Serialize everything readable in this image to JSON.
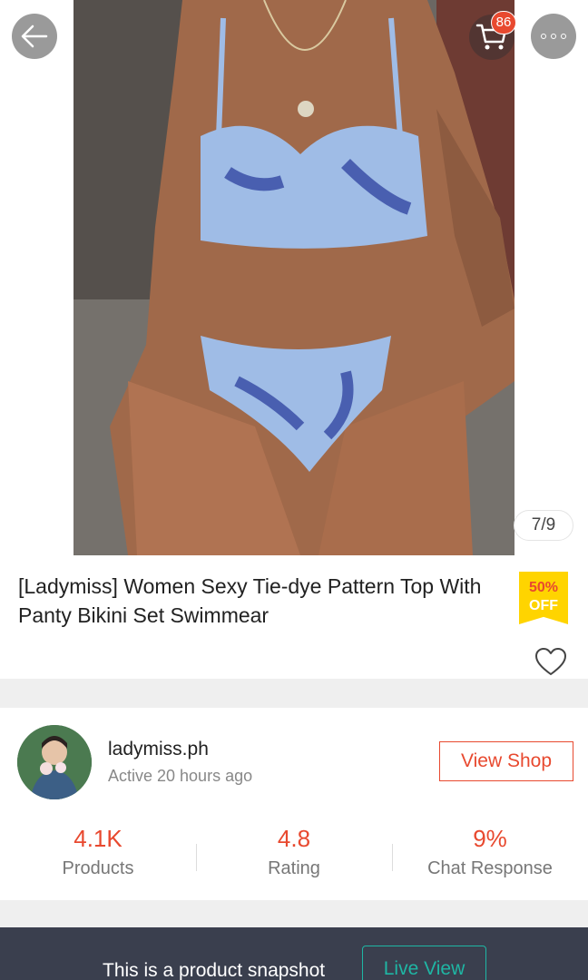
{
  "header": {
    "back_icon": "arrow-left-icon",
    "cart_icon": "shopping-cart-icon",
    "cart_badge": "86",
    "more_icon": "more-dots-icon"
  },
  "gallery": {
    "counter": "7/9"
  },
  "product": {
    "title": "[Ladymiss] Women Sexy Tie-dye Pattern Top With Panty Bikini Set Swimmear",
    "discount_percent": "50%",
    "discount_label": "OFF",
    "favorite_icon": "heart-outline-icon"
  },
  "shop": {
    "name": "ladymiss.ph",
    "active_status": "Active 20 hours ago",
    "view_shop_label": "View Shop",
    "stats": [
      {
        "value": "4.1K",
        "label": "Products"
      },
      {
        "value": "4.8",
        "label": "Rating"
      },
      {
        "value": "9%",
        "label": "Chat Response"
      }
    ]
  },
  "snapshot_bar": {
    "text": "This is a product snapshot",
    "live_view_label": "Live View"
  },
  "colors": {
    "accent": "#e8492f",
    "discount_bg": "#ffd400",
    "bar_bg": "#3a3f4e",
    "live_view": "#1fb6a4"
  }
}
